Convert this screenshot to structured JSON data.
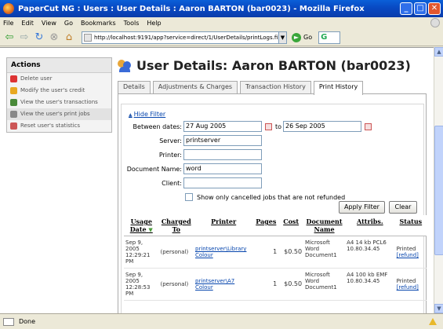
{
  "window": {
    "title": "PaperCut NG : Users : User Details : Aaron BARTON (bar0023) - Mozilla Firefox"
  },
  "menu": [
    "File",
    "Edit",
    "View",
    "Go",
    "Bookmarks",
    "Tools",
    "Help"
  ],
  "nav": {
    "url": "http://localhost:9191/app?service=direct/1/UserDetails/printLogs.filter.$Dat",
    "go_label": "Go",
    "search_label": "G"
  },
  "sidebar": {
    "title": "Actions",
    "items": [
      {
        "label": "Delete user",
        "icon": "delete-icon"
      },
      {
        "label": "Modify the user's credit",
        "icon": "coin-icon"
      },
      {
        "label": "View the user's transactions",
        "icon": "chart-icon"
      },
      {
        "label": "View the user's print jobs",
        "icon": "printer-icon"
      },
      {
        "label": "Reset user's statistics",
        "icon": "reset-icon"
      }
    ]
  },
  "page": {
    "title": "User Details: Aaron BARTON (bar0023)"
  },
  "tabs": [
    "Details",
    "Adjustments & Charges",
    "Transaction History",
    "Print History"
  ],
  "filter": {
    "hide_label": "Hide Filter",
    "between_label": "Between dates:",
    "date_from": "27 Aug 2005",
    "to_label": "to",
    "date_to": "26 Sep 2005",
    "server_label": "Server:",
    "server_value": "printserver",
    "printer_label": "Printer:",
    "printer_value": "",
    "document_label": "Document Name:",
    "document_value": "word",
    "client_label": "Client:",
    "client_value": "",
    "cancelled_label": "Show only cancelled jobs that are not refunded",
    "apply_label": "Apply Filter",
    "clear_label": "Clear"
  },
  "table": {
    "headers": [
      "Usage Date",
      "Charged To",
      "Printer",
      "Pages",
      "Cost",
      "Document Name",
      "Attribs.",
      "Status"
    ],
    "rows": [
      {
        "date": "Sep 9, 2005 12:29:21 PM",
        "charged": "(personal)",
        "printer": "printserver\\Library Colour",
        "pages": "1",
        "cost": "$0.50",
        "document": "Microsoft Word Document1",
        "attribs": "A4 14 kb PCL6 10.80.34.45",
        "status": "Printed",
        "refund": "[refund]"
      },
      {
        "date": "Sep 9, 2005 12:28:53 PM",
        "charged": "(personal)",
        "printer": "printserver\\A7 Colour",
        "pages": "1",
        "cost": "$0.50",
        "document": "Microsoft Word Document1",
        "attribs": "A4 100 kb EMF 10.80.34.45",
        "status": "Printed",
        "refund": "[refund]"
      }
    ]
  },
  "status": {
    "text": "Done"
  }
}
